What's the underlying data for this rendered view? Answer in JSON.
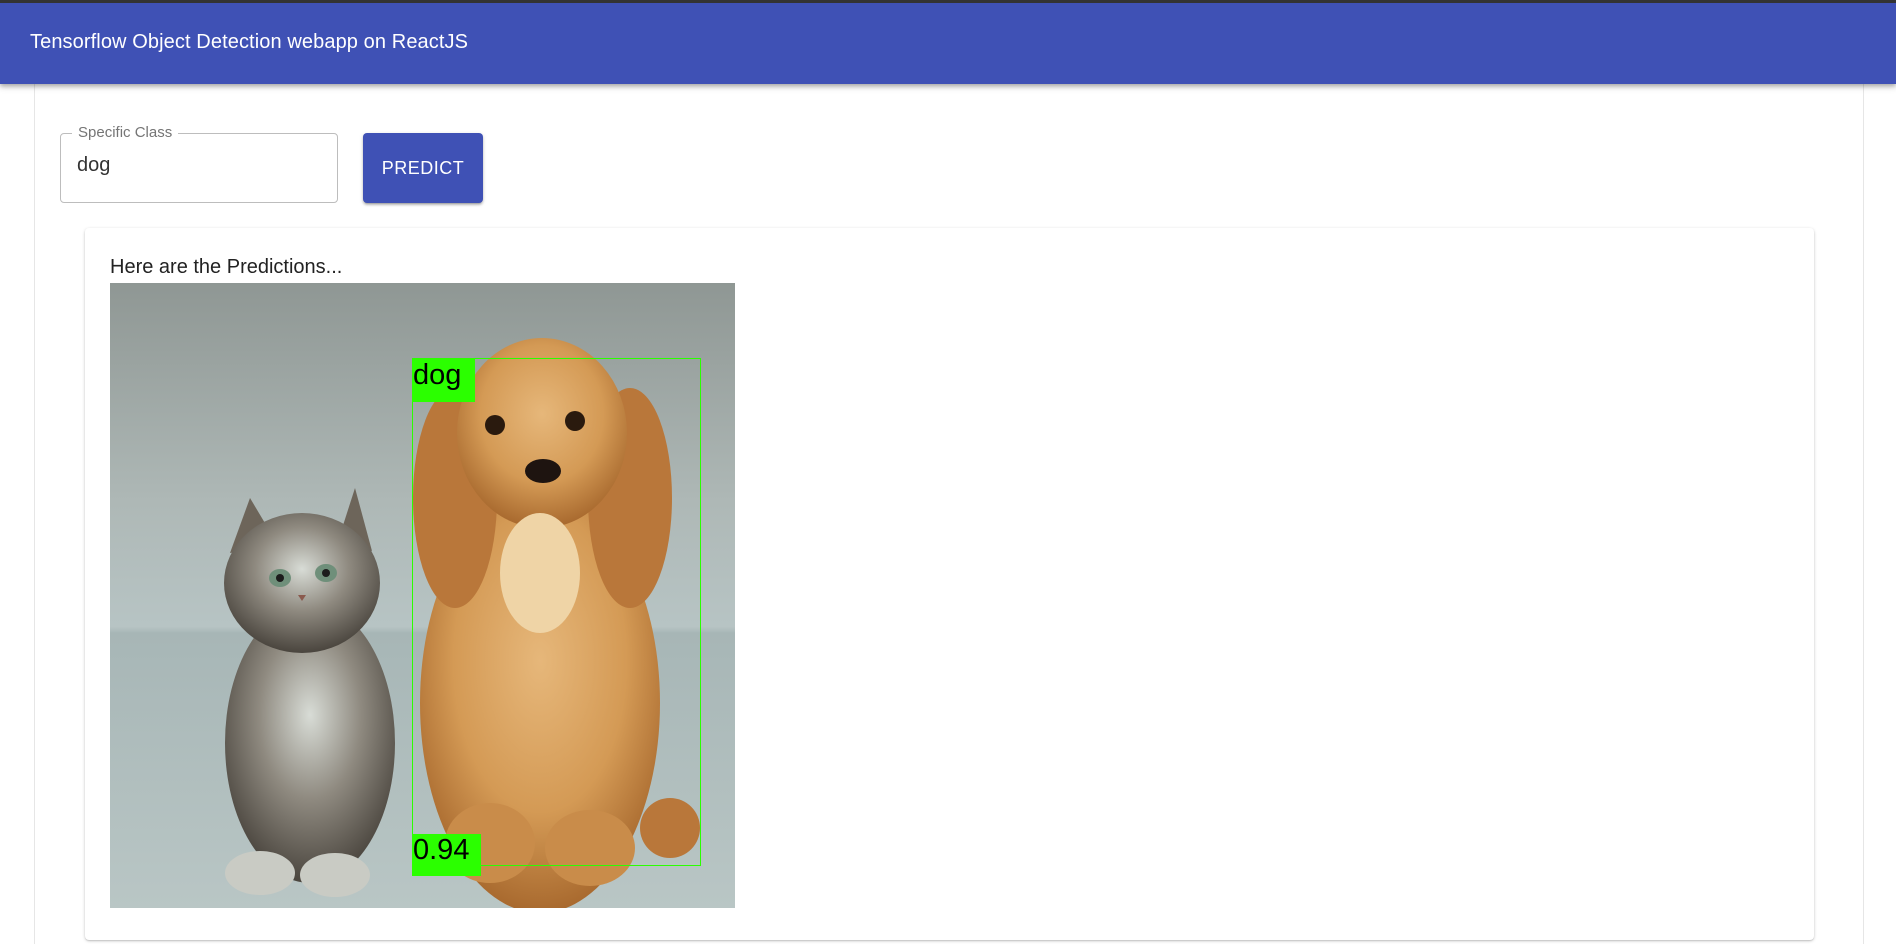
{
  "appbar": {
    "title": "Tensorflow Object Detection webapp on ReactJS",
    "color": "#3f51b5"
  },
  "form": {
    "field_label": "Specific Class",
    "field_value": "dog",
    "predict_label": "PREDICT"
  },
  "results": {
    "heading": "Here are the Predictions...",
    "detection": {
      "class": "dog",
      "score": "0.94",
      "box_color": "#2bff00"
    }
  }
}
